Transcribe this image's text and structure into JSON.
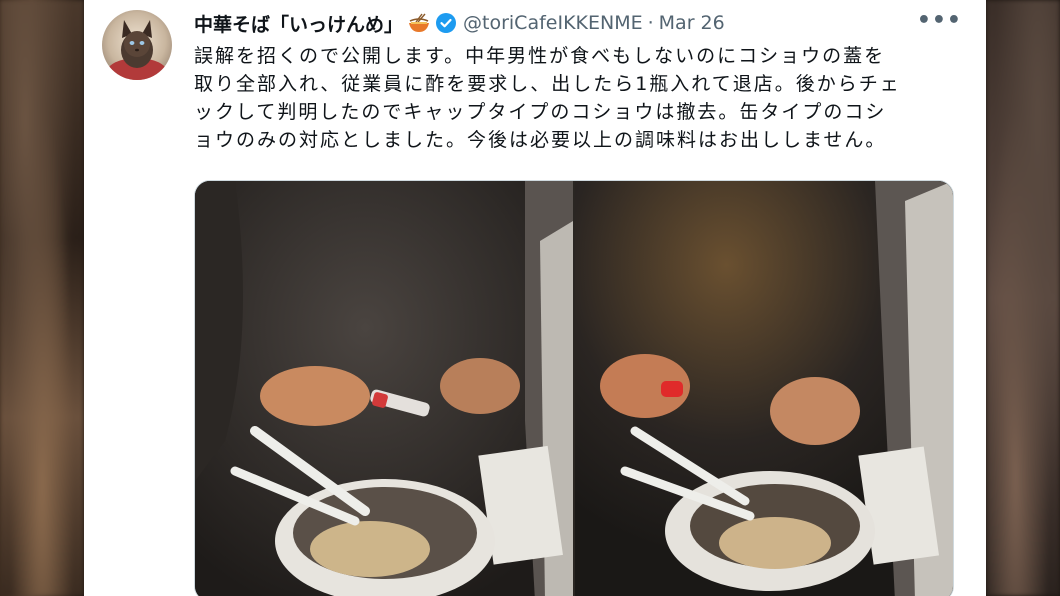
{
  "tweet": {
    "display_name": "中華そば「いっけんめ」",
    "handle": "@toriCafeIKKENME",
    "separator": "·",
    "date": "Mar 26",
    "more": "•••",
    "text_lines": [
      "誤解を招くので公開します。中年男性が食べもしないのにコショウの蓋を",
      "取り全部入れ、従業員に酢を要求し、出したら1瓶入れて退店。後からチェ",
      "ックして判明したのでキャップタイプのコショウは撤去。缶タイプのコシ",
      "ョウのみの対応としました。今後は必要以上の調味料はお出ししません。"
    ]
  },
  "icons": {
    "noodle": "ramen-bowl-icon",
    "verified": "verified-badge-icon",
    "more": "more-options-icon"
  },
  "colors": {
    "verified": "#1d9bf0",
    "secondary_text": "#536471",
    "primary_text": "#0f1419",
    "frame_accent": "#d24fd8"
  }
}
